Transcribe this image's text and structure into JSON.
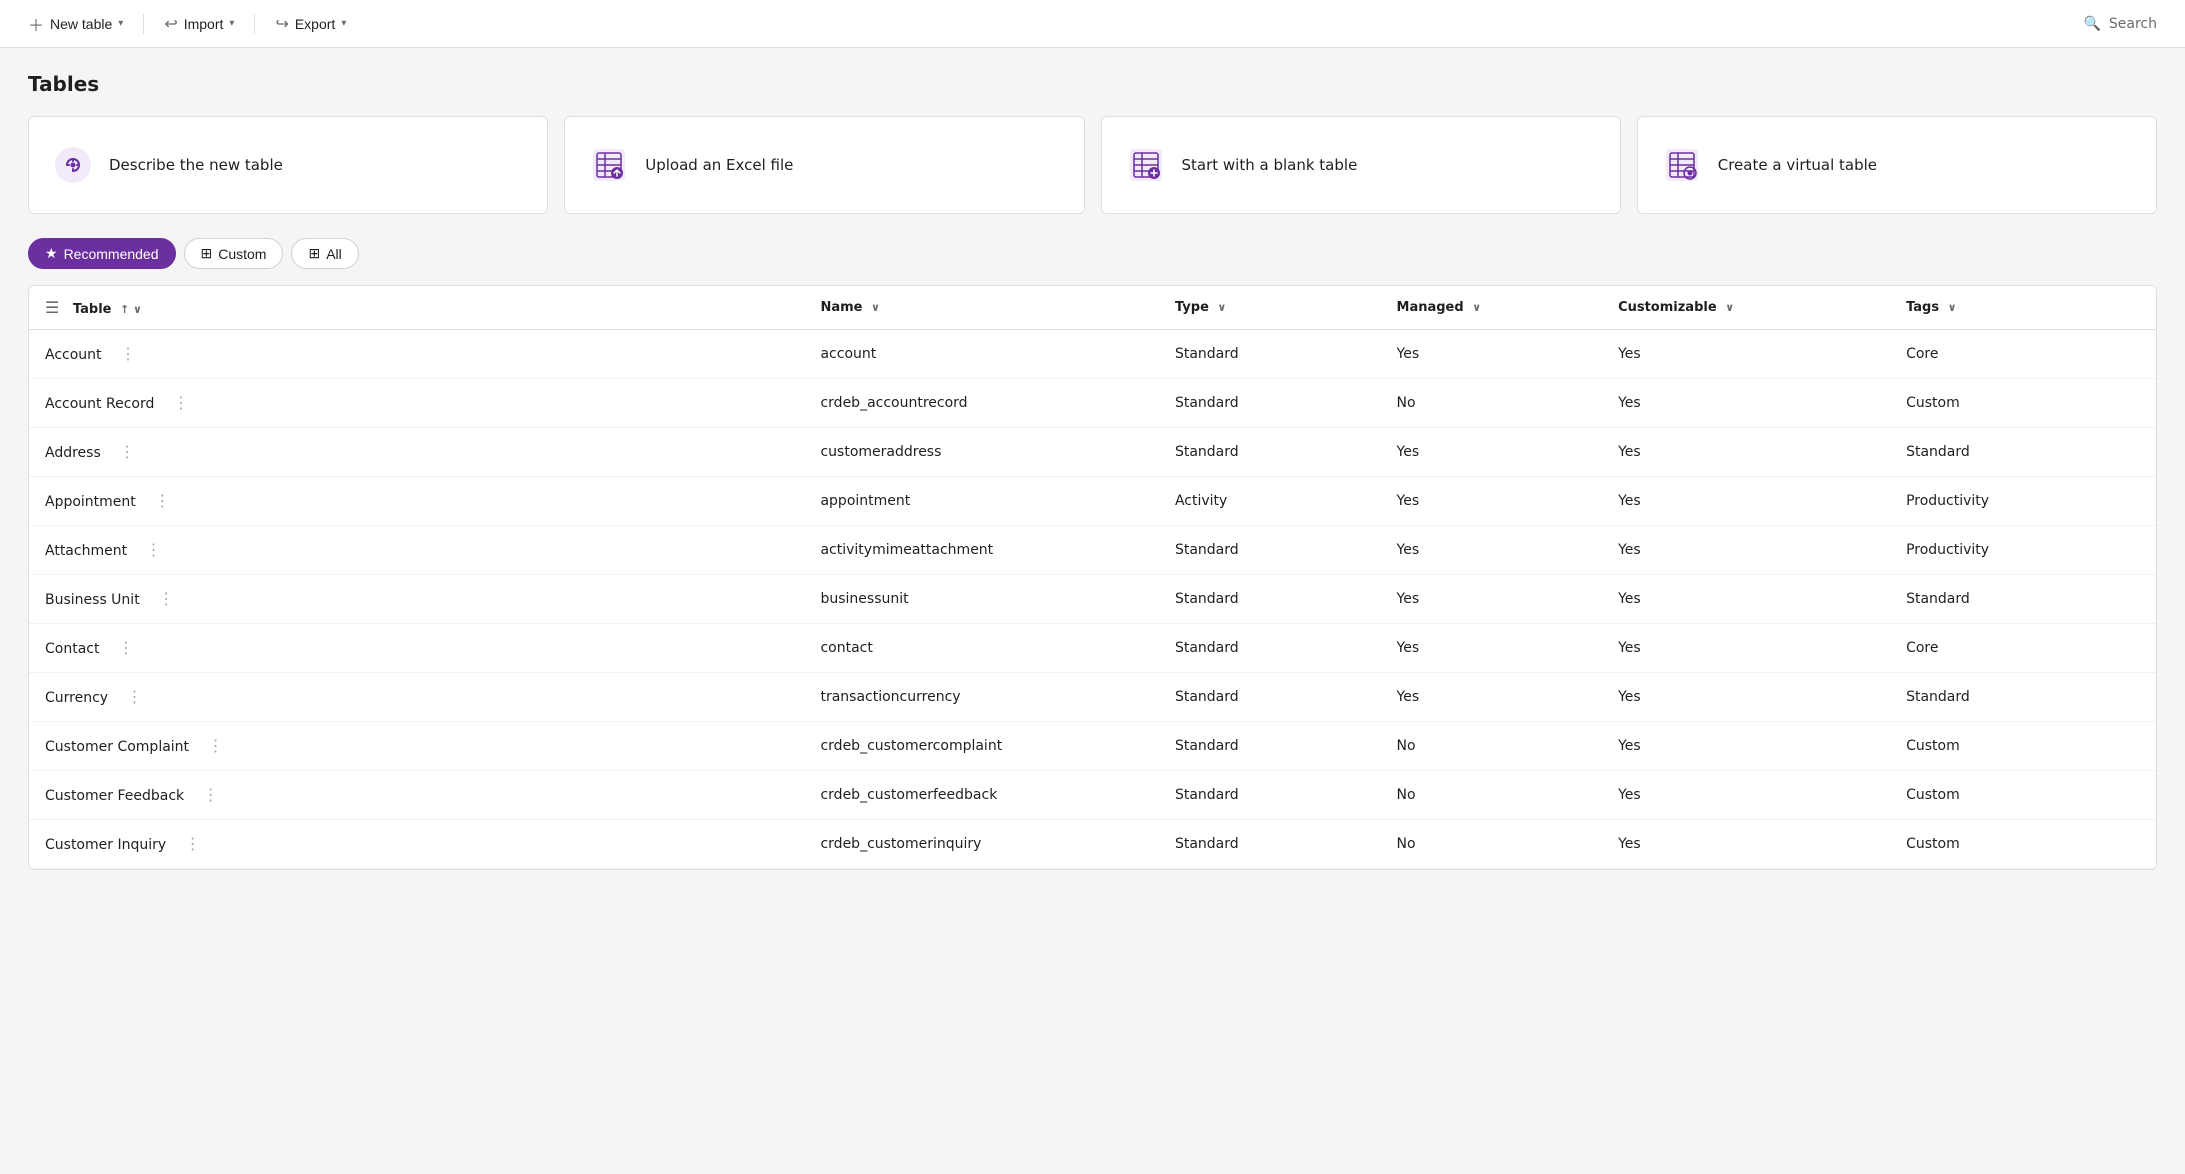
{
  "toolbar": {
    "new_table_label": "New table",
    "import_label": "Import",
    "export_label": "Export",
    "search_label": "Search"
  },
  "page": {
    "title": "Tables"
  },
  "cards": [
    {
      "id": "describe",
      "label": "Describe the new table",
      "icon": "ai"
    },
    {
      "id": "upload",
      "label": "Upload an Excel file",
      "icon": "excel"
    },
    {
      "id": "blank",
      "label": "Start with a blank table",
      "icon": "blank"
    },
    {
      "id": "virtual",
      "label": "Create a virtual table",
      "icon": "virtual"
    }
  ],
  "filter_tabs": [
    {
      "id": "recommended",
      "label": "Recommended",
      "active": true
    },
    {
      "id": "custom",
      "label": "Custom",
      "active": false
    },
    {
      "id": "all",
      "label": "All",
      "active": false
    }
  ],
  "table": {
    "columns": [
      {
        "id": "table",
        "label": "Table",
        "sortable": true,
        "sort_dir": "asc"
      },
      {
        "id": "name",
        "label": "Name",
        "sortable": true
      },
      {
        "id": "type",
        "label": "Type",
        "sortable": true
      },
      {
        "id": "managed",
        "label": "Managed",
        "sortable": true
      },
      {
        "id": "customizable",
        "label": "Customizable",
        "sortable": true
      },
      {
        "id": "tags",
        "label": "Tags",
        "sortable": true
      }
    ],
    "rows": [
      {
        "table": "Account",
        "name": "account",
        "type": "Standard",
        "managed": "Yes",
        "customizable": "Yes",
        "tags": "Core"
      },
      {
        "table": "Account Record",
        "name": "crdeb_accountrecord",
        "type": "Standard",
        "managed": "No",
        "customizable": "Yes",
        "tags": "Custom"
      },
      {
        "table": "Address",
        "name": "customeraddress",
        "type": "Standard",
        "managed": "Yes",
        "customizable": "Yes",
        "tags": "Standard"
      },
      {
        "table": "Appointment",
        "name": "appointment",
        "type": "Activity",
        "managed": "Yes",
        "customizable": "Yes",
        "tags": "Productivity"
      },
      {
        "table": "Attachment",
        "name": "activitymimeattachment",
        "type": "Standard",
        "managed": "Yes",
        "customizable": "Yes",
        "tags": "Productivity"
      },
      {
        "table": "Business Unit",
        "name": "businessunit",
        "type": "Standard",
        "managed": "Yes",
        "customizable": "Yes",
        "tags": "Standard"
      },
      {
        "table": "Contact",
        "name": "contact",
        "type": "Standard",
        "managed": "Yes",
        "customizable": "Yes",
        "tags": "Core"
      },
      {
        "table": "Currency",
        "name": "transactioncurrency",
        "type": "Standard",
        "managed": "Yes",
        "customizable": "Yes",
        "tags": "Standard"
      },
      {
        "table": "Customer Complaint",
        "name": "crdeb_customercomplaint",
        "type": "Standard",
        "managed": "No",
        "customizable": "Yes",
        "tags": "Custom"
      },
      {
        "table": "Customer Feedback",
        "name": "crdeb_customerfeedback",
        "type": "Standard",
        "managed": "No",
        "customizable": "Yes",
        "tags": "Custom"
      },
      {
        "table": "Customer Inquiry",
        "name": "crdeb_customerinquiry",
        "type": "Standard",
        "managed": "No",
        "customizable": "Yes",
        "tags": "Custom"
      }
    ]
  }
}
